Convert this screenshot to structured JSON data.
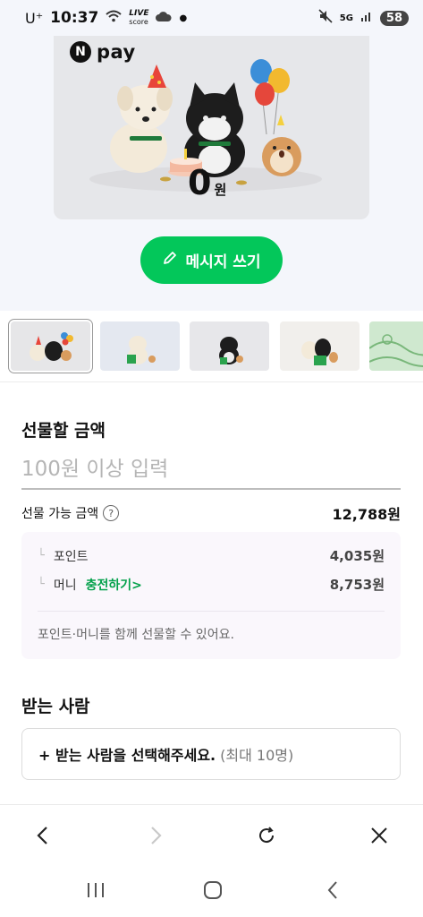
{
  "status_bar": {
    "carrier": "U⁺",
    "time": "10:37",
    "live_score_top": "LIVE",
    "live_score_bottom": "score",
    "network": "5G",
    "battery": "58"
  },
  "card": {
    "brand_badge": "N",
    "brand_text": "pay",
    "amount": "0",
    "amount_unit": "원"
  },
  "message_button": {
    "label": "메시지 쓰기"
  },
  "gift_amount": {
    "title": "선물할 금액",
    "placeholder": "100원 이상 입력",
    "available_label": "선물 가능 금액",
    "available_value": "12,788원",
    "points_label": "포인트",
    "points_value": "4,035원",
    "money_label": "머니",
    "charge_link": "충전하기>",
    "money_value": "8,753원",
    "note": "포인트·머니를 함께 선물할 수 있어요."
  },
  "recipient": {
    "title": "받는 사람",
    "select_label": "+ 받는 사람을 선택해주세요.",
    "select_sub": "(최대 10명)"
  },
  "colors": {
    "accent": "#03c75a",
    "charge_link": "#03a14b",
    "background_top": "#f4f6fb"
  }
}
